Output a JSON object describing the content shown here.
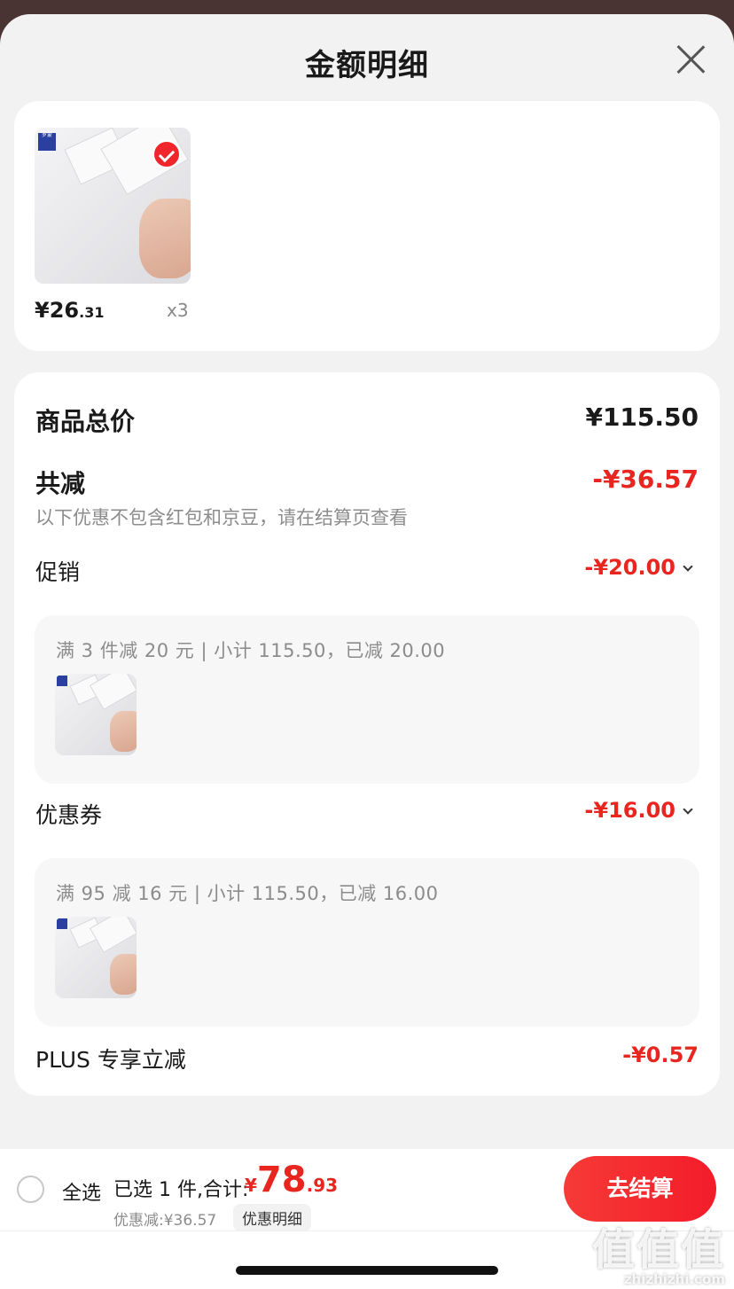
{
  "sheet": {
    "title": "金额明细"
  },
  "product": {
    "price_int": "¥26",
    "price_dec": ".31",
    "qty": "x3",
    "logo_text": "罗蒙"
  },
  "summary": {
    "total_label": "商品总价",
    "total_value": "¥115.50",
    "reduce_label": "共减",
    "reduce_value": "-¥36.57",
    "note": "以下优惠不包含红包和京豆，请在结算页查看"
  },
  "promo": {
    "label": "促销",
    "value": "-¥20.00",
    "detail": "满 3 件减 20 元 | 小计 115.50，已减 20.00"
  },
  "coupon": {
    "label": "优惠券",
    "value": "-¥16.00",
    "detail": "满 95 减 16 元 | 小计 115.50，已减 16.00"
  },
  "plus": {
    "label": "PLUS 专享立减",
    "value": "-¥0.57"
  },
  "footer": {
    "select_all": "全选",
    "selected": "已选 1 件,合计:",
    "total_yen": "¥",
    "total_int": "78",
    "total_dec": ".93",
    "discount": "优惠减:¥36.57",
    "detail_btn": "优惠明细",
    "checkout": "去结算"
  },
  "watermark": {
    "big": "值值值",
    "small": "zhizhizhi.com"
  },
  "colors": {
    "accent": "#e8261f",
    "background": "#f2f2f2"
  }
}
